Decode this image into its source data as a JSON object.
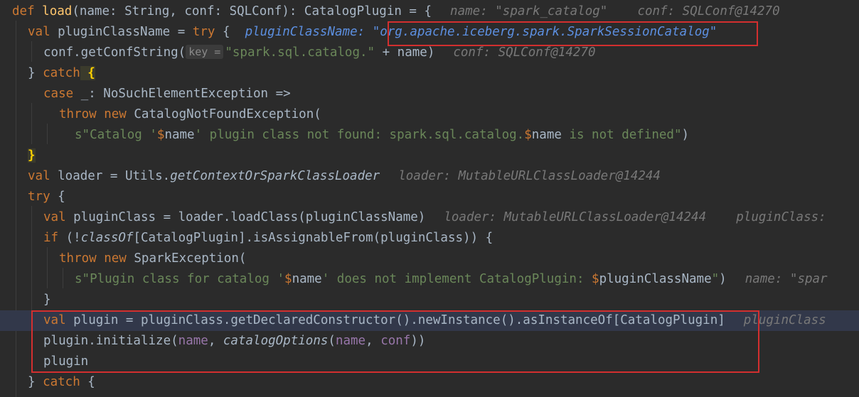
{
  "lines": [
    {
      "parts": [
        "def",
        "load",
        "(name: String, conf: SQLConf): CatalogPlugin = {"
      ],
      "hint": "name: \"spark_catalog\"    conf: SQLConf@14270"
    },
    {
      "parts": [
        "val",
        " pluginClassName = ",
        "try",
        " {"
      ],
      "hint_label": "pluginClassName:",
      "hint_value": "\"org.apache.iceberg.spark.SparkSessionCatalog\""
    },
    {
      "parts": [
        "conf.getConfString(",
        "key =",
        "\"spark.sql.catalog.\"",
        " + name)"
      ],
      "hint": "conf: SQLConf@14270"
    },
    {
      "parts": [
        "} ",
        "catch",
        " {"
      ]
    },
    {
      "parts": [
        "case",
        " _: NoSuchElementException =>"
      ]
    },
    {
      "parts": [
        "throw",
        " ",
        "new",
        " CatalogNotFoundException("
      ]
    },
    {
      "parts": [
        "s\"Catalog '",
        "$",
        "name",
        "' plugin class not found: spark.sql.catalog.",
        "$",
        "name",
        " is not defined\"",
        ")"
      ]
    },
    {
      "parts": [
        "}"
      ]
    },
    {
      "parts": [
        "val",
        " loader = Utils.",
        "getContextOrSparkClassLoader"
      ],
      "hint": "loader: MutableURLClassLoader@14244"
    },
    {
      "parts": [
        "try",
        " {"
      ]
    },
    {
      "parts": [
        "val",
        " pluginClass = loader.loadClass(pluginClassName)"
      ],
      "hint": "loader: MutableURLClassLoader@14244    pluginClass:"
    },
    {
      "parts": [
        "if",
        " (!",
        "classOf",
        "[CatalogPlugin].isAssignableFrom(pluginClass)) {"
      ]
    },
    {
      "parts": [
        "throw",
        " ",
        "new",
        " SparkException("
      ]
    },
    {
      "parts": [
        "s\"Plugin class for catalog '",
        "$",
        "name",
        "' does not implement CatalogPlugin: ",
        "$",
        "pluginClassName",
        "\"",
        ")"
      ],
      "hint": "name: \"spar"
    },
    {
      "parts": [
        "}"
      ]
    },
    {
      "parts": [
        "val",
        " plugin = pluginClass.getDeclaredConstructor().newInstance().asInstanceOf[CatalogPlugin]"
      ],
      "hint": "pluginClass"
    },
    {
      "parts": [
        "plugin.initialize(",
        "name",
        ", ",
        "catalogOptions",
        "(",
        "name",
        ", ",
        "conf",
        "))"
      ]
    },
    {
      "parts": [
        "plugin"
      ]
    },
    {
      "parts": [
        "} ",
        "catch",
        " {"
      ]
    }
  ]
}
